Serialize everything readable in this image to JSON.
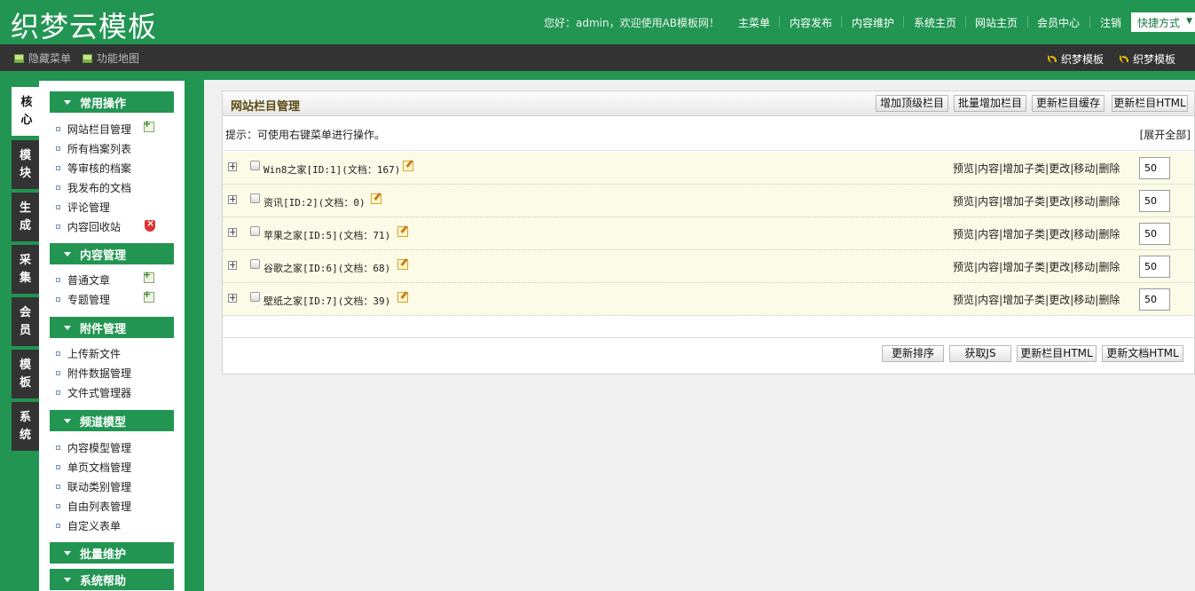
{
  "header": {
    "logo": "织梦云模板",
    "greeting": "您好：admin，欢迎使用AB模板网！",
    "nav": [
      "主菜单",
      "内容发布",
      "内容维护",
      "系统主页",
      "网站主页",
      "会员中心",
      "注销"
    ],
    "quick": "快捷方式"
  },
  "toolbar": {
    "left": [
      "隐藏菜单",
      "功能地图"
    ],
    "right": [
      "织梦模板",
      "织梦模板"
    ]
  },
  "vtabs": [
    {
      "l1": "核",
      "l2": "心"
    },
    {
      "l1": "模",
      "l2": "块"
    },
    {
      "l1": "生",
      "l2": "成"
    },
    {
      "l1": "采",
      "l2": "集"
    },
    {
      "l1": "会",
      "l2": "员"
    },
    {
      "l1": "模",
      "l2": "板"
    },
    {
      "l1": "系",
      "l2": "统"
    }
  ],
  "menu": {
    "groups": [
      {
        "title": "常用操作",
        "items": [
          "网站栏目管理",
          "所有档案列表",
          "等审核的档案",
          "我发布的文档",
          "评论管理",
          "内容回收站"
        ]
      },
      {
        "title": "内容管理",
        "items": [
          "普通文章",
          "专题管理"
        ]
      },
      {
        "title": "附件管理",
        "items": [
          "上传新文件",
          "附件数据管理",
          "文件式管理器"
        ]
      },
      {
        "title": "频道模型",
        "items": [
          "内容模型管理",
          "单页文档管理",
          "联动类别管理",
          "自由列表管理",
          "自定义表单"
        ]
      },
      {
        "title": "批量维护",
        "items": []
      },
      {
        "title": "系统帮助",
        "items": []
      }
    ]
  },
  "panel": {
    "title": "网站栏目管理",
    "top_buttons": [
      "增加顶级栏目",
      "批量增加栏目",
      "更新栏目缓存",
      "更新栏目HTML"
    ],
    "tip": "提示：可使用右键菜单进行操作。",
    "expand_all": "[展开全部]",
    "op_labels": [
      "预览",
      "内容",
      "增加子类",
      "更改",
      "移动",
      "删除"
    ],
    "rows": [
      {
        "name": "Win8之家[ID:1](文档：167)",
        "order": "50"
      },
      {
        "name": "资讯[ID:2](文档：0)",
        "order": "50"
      },
      {
        "name": "苹果之家[ID:5](文档：71)",
        "order": "50"
      },
      {
        "name": "谷歌之家[ID:6](文档：68)",
        "order": "50"
      },
      {
        "name": "壁纸之家[ID:7](文档：39)",
        "order": "50"
      }
    ],
    "bottom_buttons": [
      "更新排序",
      "获取JS",
      "更新栏目HTML",
      "更新文档HTML"
    ]
  }
}
